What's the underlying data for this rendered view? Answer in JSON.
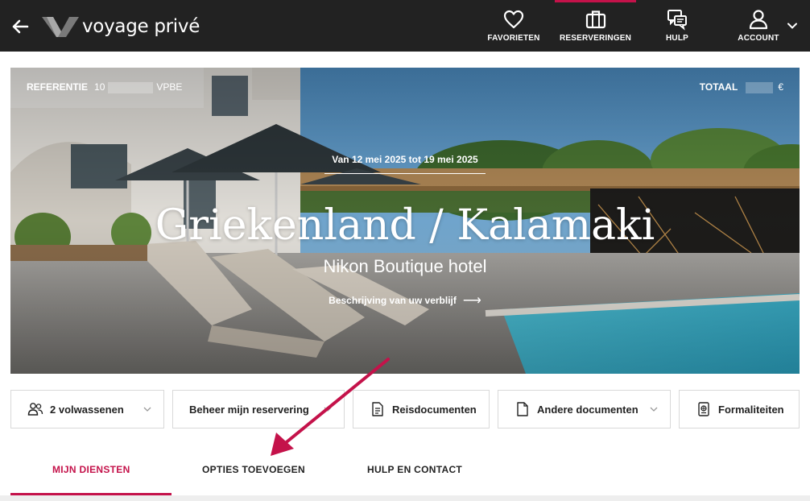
{
  "header": {
    "logo_text": "voyage privé",
    "nav": [
      {
        "label": "FAVORIETEN",
        "icon": "heart-icon"
      },
      {
        "label": "RESERVERINGEN",
        "icon": "suitcase-icon"
      },
      {
        "label": "HULP",
        "icon": "chat-icon"
      },
      {
        "label": "ACCOUNT",
        "icon": "user-icon"
      }
    ],
    "active_nav": "RESERVERINGEN"
  },
  "hero": {
    "reference_label": "REFERENTIE",
    "reference_prefix": "10",
    "reference_suffix": "VPBE",
    "total_label": "TOTAAL",
    "currency": "€",
    "dates": "Van 12 mei 2025 tot 19 mei 2025",
    "destination": "Griekenland / Kalamaki",
    "hotel": "Nikon Boutique hotel",
    "description_link": "Beschrijving van uw verblijf"
  },
  "actions": [
    {
      "label": "2 volwassenen",
      "icon": "people-icon",
      "dropdown": true
    },
    {
      "label": "Beheer mijn reservering",
      "icon": "",
      "dropdown": true
    },
    {
      "label": "Reisdocumenten",
      "icon": "document-icon",
      "dropdown": false
    },
    {
      "label": "Andere documenten",
      "icon": "file-icon",
      "dropdown": true
    },
    {
      "label": "Formaliteiten",
      "icon": "passport-icon",
      "dropdown": false
    }
  ],
  "tabs": [
    {
      "label": "MIJN DIENSTEN",
      "active": true
    },
    {
      "label": "OPTIES TOEVOEGEN",
      "active": false
    },
    {
      "label": "HULP EN CONTACT",
      "active": false
    }
  ],
  "colors": {
    "accent": "#c4124a",
    "topbar": "#222222"
  }
}
